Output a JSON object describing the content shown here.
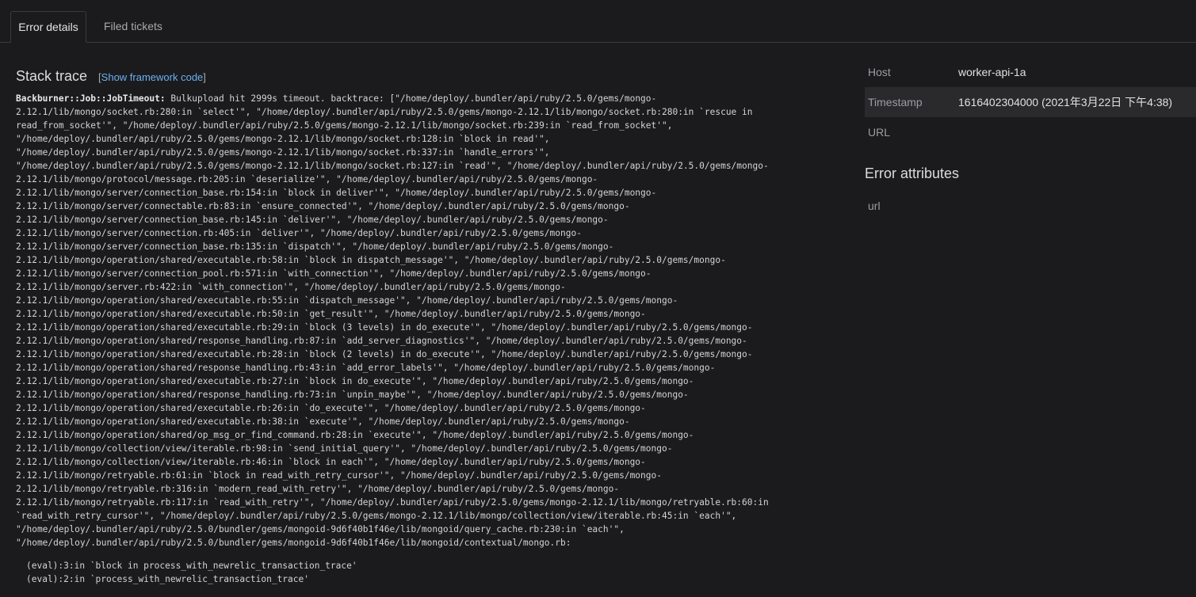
{
  "tabs": [
    {
      "label": "Error details",
      "active": true
    },
    {
      "label": "Filed tickets",
      "active": false
    }
  ],
  "stack_trace": {
    "title": "Stack trace",
    "toggle_open": "[",
    "toggle_link": "Show framework code",
    "toggle_close": "]",
    "error_class": "Backburner::Job::JobTimeout:",
    "first_line_rest": " Bulkupload hit 2999s timeout. backtrace: [\"/home/deploy/.bundler/api/ruby/2.5.0/gems/mongo-",
    "lines": [
      "2.12.1/lib/mongo/socket.rb:280:in `select'\", \"/home/deploy/.bundler/api/ruby/2.5.0/gems/mongo-2.12.1/lib/mongo/socket.rb:280:in `rescue in",
      "read_from_socket'\", \"/home/deploy/.bundler/api/ruby/2.5.0/gems/mongo-2.12.1/lib/mongo/socket.rb:239:in `read_from_socket'\",",
      "\"/home/deploy/.bundler/api/ruby/2.5.0/gems/mongo-2.12.1/lib/mongo/socket.rb:128:in `block in read'\",",
      "\"/home/deploy/.bundler/api/ruby/2.5.0/gems/mongo-2.12.1/lib/mongo/socket.rb:337:in `handle_errors'\",",
      "\"/home/deploy/.bundler/api/ruby/2.5.0/gems/mongo-2.12.1/lib/mongo/socket.rb:127:in `read'\", \"/home/deploy/.bundler/api/ruby/2.5.0/gems/mongo-",
      "2.12.1/lib/mongo/protocol/message.rb:205:in `deserialize'\", \"/home/deploy/.bundler/api/ruby/2.5.0/gems/mongo-",
      "2.12.1/lib/mongo/server/connection_base.rb:154:in `block in deliver'\", \"/home/deploy/.bundler/api/ruby/2.5.0/gems/mongo-",
      "2.12.1/lib/mongo/server/connectable.rb:83:in `ensure_connected'\", \"/home/deploy/.bundler/api/ruby/2.5.0/gems/mongo-",
      "2.12.1/lib/mongo/server/connection_base.rb:145:in `deliver'\", \"/home/deploy/.bundler/api/ruby/2.5.0/gems/mongo-",
      "2.12.1/lib/mongo/server/connection.rb:405:in `deliver'\", \"/home/deploy/.bundler/api/ruby/2.5.0/gems/mongo-",
      "2.12.1/lib/mongo/server/connection_base.rb:135:in `dispatch'\", \"/home/deploy/.bundler/api/ruby/2.5.0/gems/mongo-",
      "2.12.1/lib/mongo/operation/shared/executable.rb:58:in `block in dispatch_message'\", \"/home/deploy/.bundler/api/ruby/2.5.0/gems/mongo-",
      "2.12.1/lib/mongo/server/connection_pool.rb:571:in `with_connection'\", \"/home/deploy/.bundler/api/ruby/2.5.0/gems/mongo-",
      "2.12.1/lib/mongo/server.rb:422:in `with_connection'\", \"/home/deploy/.bundler/api/ruby/2.5.0/gems/mongo-",
      "2.12.1/lib/mongo/operation/shared/executable.rb:55:in `dispatch_message'\", \"/home/deploy/.bundler/api/ruby/2.5.0/gems/mongo-",
      "2.12.1/lib/mongo/operation/shared/executable.rb:50:in `get_result'\", \"/home/deploy/.bundler/api/ruby/2.5.0/gems/mongo-",
      "2.12.1/lib/mongo/operation/shared/executable.rb:29:in `block (3 levels) in do_execute'\", \"/home/deploy/.bundler/api/ruby/2.5.0/gems/mongo-",
      "2.12.1/lib/mongo/operation/shared/response_handling.rb:87:in `add_server_diagnostics'\", \"/home/deploy/.bundler/api/ruby/2.5.0/gems/mongo-",
      "2.12.1/lib/mongo/operation/shared/executable.rb:28:in `block (2 levels) in do_execute'\", \"/home/deploy/.bundler/api/ruby/2.5.0/gems/mongo-",
      "2.12.1/lib/mongo/operation/shared/response_handling.rb:43:in `add_error_labels'\", \"/home/deploy/.bundler/api/ruby/2.5.0/gems/mongo-",
      "2.12.1/lib/mongo/operation/shared/executable.rb:27:in `block in do_execute'\", \"/home/deploy/.bundler/api/ruby/2.5.0/gems/mongo-",
      "2.12.1/lib/mongo/operation/shared/response_handling.rb:73:in `unpin_maybe'\", \"/home/deploy/.bundler/api/ruby/2.5.0/gems/mongo-",
      "2.12.1/lib/mongo/operation/shared/executable.rb:26:in `do_execute'\", \"/home/deploy/.bundler/api/ruby/2.5.0/gems/mongo-",
      "2.12.1/lib/mongo/operation/shared/executable.rb:38:in `execute'\", \"/home/deploy/.bundler/api/ruby/2.5.0/gems/mongo-",
      "2.12.1/lib/mongo/operation/shared/op_msg_or_find_command.rb:28:in `execute'\", \"/home/deploy/.bundler/api/ruby/2.5.0/gems/mongo-",
      "2.12.1/lib/mongo/collection/view/iterable.rb:98:in `send_initial_query'\", \"/home/deploy/.bundler/api/ruby/2.5.0/gems/mongo-",
      "2.12.1/lib/mongo/collection/view/iterable.rb:46:in `block in each'\", \"/home/deploy/.bundler/api/ruby/2.5.0/gems/mongo-",
      "2.12.1/lib/mongo/retryable.rb:61:in `block in read_with_retry_cursor'\", \"/home/deploy/.bundler/api/ruby/2.5.0/gems/mongo-",
      "2.12.1/lib/mongo/retryable.rb:316:in `modern_read_with_retry'\", \"/home/deploy/.bundler/api/ruby/2.5.0/gems/mongo-",
      "2.12.1/lib/mongo/retryable.rb:117:in `read_with_retry'\", \"/home/deploy/.bundler/api/ruby/2.5.0/gems/mongo-2.12.1/lib/mongo/retryable.rb:60:in",
      "`read_with_retry_cursor'\", \"/home/deploy/.bundler/api/ruby/2.5.0/gems/mongo-2.12.1/lib/mongo/collection/view/iterable.rb:45:in `each'\",",
      "\"/home/deploy/.bundler/api/ruby/2.5.0/bundler/gems/mongoid-9d6f40b1f46e/lib/mongoid/query_cache.rb:230:in `each'\",",
      "\"/home/deploy/.bundler/api/ruby/2.5.0/bundler/gems/mongoid-9d6f40b1f46e/lib/mongoid/contextual/mongo.rb:"
    ],
    "frames": [
      "(eval):3:in `block in process_with_newrelic_transaction_trace'",
      "(eval):2:in `process_with_newrelic_transaction_trace'"
    ]
  },
  "details": {
    "rows": [
      {
        "key": "Host",
        "value": "worker-api-1a"
      },
      {
        "key": "Timestamp",
        "value": "1616402304000 (2021年3月22日 下午4:38)"
      },
      {
        "key": "URL",
        "value": ""
      }
    ]
  },
  "error_attributes": {
    "title": "Error attributes",
    "rows": [
      {
        "key": "url",
        "value": ""
      }
    ]
  },
  "colors": {
    "background": "#1b1b1d",
    "link": "#6ab0f3",
    "alt_row": "#2a2a2d"
  }
}
